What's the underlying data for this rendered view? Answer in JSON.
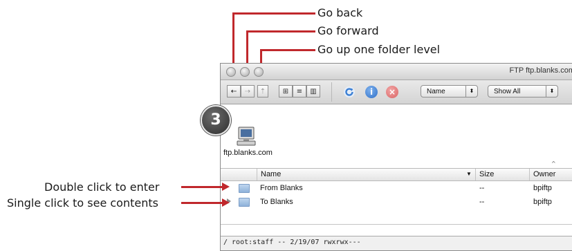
{
  "callouts": {
    "go_back": "Go back",
    "go_forward": "Go forward",
    "go_up": "Go up one folder level",
    "double_click": "Double click to enter",
    "single_click": "Single click to see contents"
  },
  "step_badge": "3",
  "window": {
    "title": "FTP ftp.blanks.com",
    "toolbar": {
      "back_glyph": "⇠",
      "forward_glyph": "⇢",
      "up_glyph": "⇡",
      "view_icon_glyph": "⊞",
      "view_list_glyph": "≡",
      "view_column_glyph": "▥",
      "info_glyph": "i",
      "stop_glyph": "×",
      "sort_popup": "Name",
      "filter_popup": "Show All",
      "stepper_glyph": "⬍"
    },
    "host": {
      "label": "ftp.blanks.com"
    },
    "columns": [
      "Name",
      "Size",
      "Owner"
    ],
    "rows": [
      {
        "name": "From Blanks",
        "size": "--",
        "owner": "bpiftp",
        "has_disclosure": false
      },
      {
        "name": "To Blanks",
        "size": "--",
        "owner": "bpiftp",
        "has_disclosure": true
      }
    ],
    "status": "/  root:staff  --  2/19/07  rwxrwx---"
  },
  "colors": {
    "callout_red": "#c0282c",
    "refresh_blue": "#3b7fd4",
    "info_blue": "#3b7fd4",
    "stop_red": "#e05c5c"
  }
}
